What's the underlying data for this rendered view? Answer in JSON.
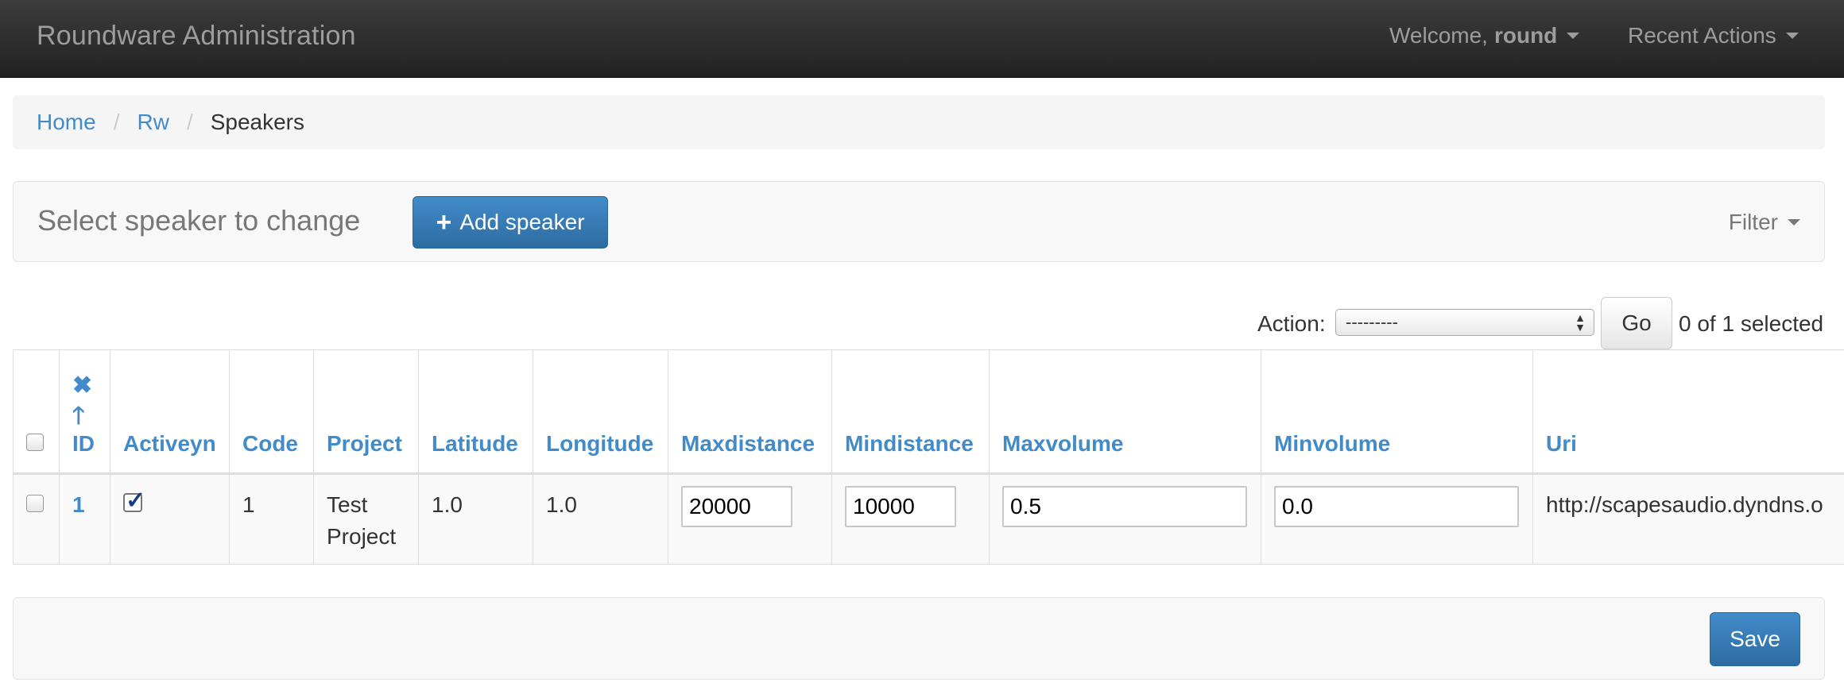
{
  "navbar": {
    "brand": "Roundware Administration",
    "welcome_prefix": "Welcome,",
    "username": "round",
    "recent_actions": "Recent Actions"
  },
  "breadcrumb": {
    "home": "Home",
    "app": "Rw",
    "current": "Speakers",
    "separator": "/"
  },
  "header": {
    "title": "Select speaker to change",
    "add_button": "Add speaker",
    "filter": "Filter"
  },
  "actions": {
    "label": "Action:",
    "selected_option": "---------",
    "go_button": "Go",
    "selected_count": "0 of 1 selected"
  },
  "table": {
    "columns": [
      "ID",
      "Activeyn",
      "Code",
      "Project",
      "Latitude",
      "Longitude",
      "Maxdistance",
      "Mindistance",
      "Maxvolume",
      "Minvolume",
      "Uri"
    ],
    "sort_icons": [
      "✖",
      "🡑"
    ],
    "rows": [
      {
        "id": "1",
        "activeyn": true,
        "code": "1",
        "project": "Test Project",
        "latitude": "1.0",
        "longitude": "1.0",
        "maxdistance": "20000",
        "mindistance": "10000",
        "maxvolume": "0.5",
        "minvolume": "0.0",
        "uri": "http://scapesaudio.dyndns.o"
      }
    ]
  },
  "footer": {
    "save_button": "Save"
  },
  "colors": {
    "navbar": "#222222",
    "primary": "#428bca",
    "muted": "#777777"
  }
}
